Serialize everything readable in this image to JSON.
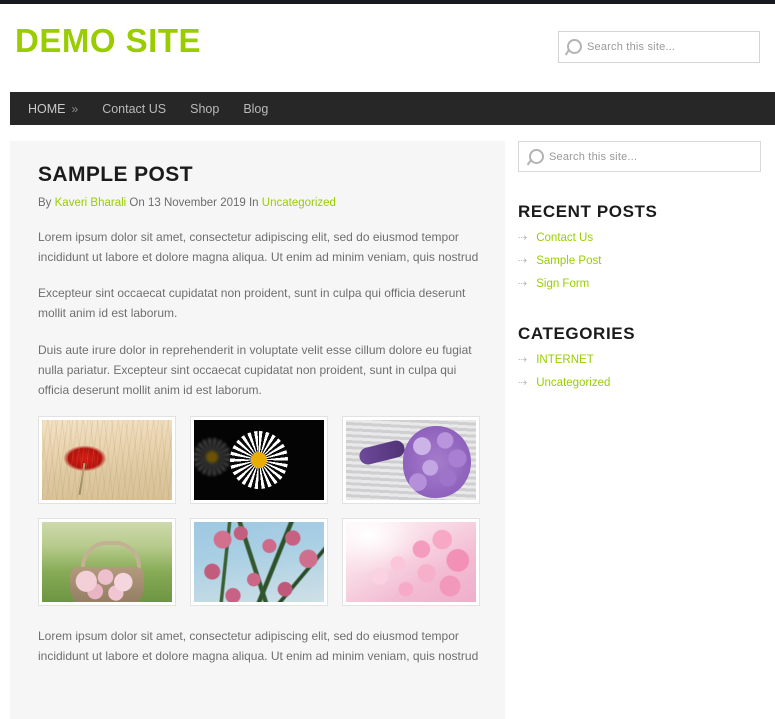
{
  "site": {
    "logo_text": "DEMO SITE",
    "logo_color": "#9ACD00"
  },
  "header": {
    "search": {
      "icon": "search-icon",
      "placeholder": "Search this site...",
      "value": ""
    }
  },
  "nav": {
    "items": [
      {
        "label": "HOME",
        "caret": "»",
        "has_caret": true
      },
      {
        "label": "Contact US",
        "has_caret": false
      },
      {
        "label": "Shop",
        "has_caret": false
      },
      {
        "label": "Blog",
        "has_caret": false
      }
    ]
  },
  "post": {
    "title": "SAMPLE POST",
    "byline": {
      "by_label": "By",
      "author": "Kaveri Bharali",
      "on_label": "On",
      "date": "13 November 2019",
      "in_label": "In",
      "category": "Uncategorized"
    },
    "paragraphs": [
      "Lorem ipsum dolor sit amet, consectetur adipiscing elit, sed do eiusmod tempor incididunt ut labore et dolore magna aliqua. Ut enim ad minim veniam, quis nostrud",
      "Excepteur sint occaecat cupidatat non proident, sunt in culpa qui officia deserunt mollit anim id est laborum.",
      "Duis aute irure dolor in reprehenderit in voluptate velit esse cillum dolore eu fugiat nulla pariatur. Excepteur sint occaecat cupidatat non proident, sunt in culpa qui officia deserunt mollit anim id est laborum."
    ],
    "gallery": [
      {
        "name": "red-poppy-in-wheat-field"
      },
      {
        "name": "white-daisy-on-black-background"
      },
      {
        "name": "purple-bouquet-on-knit-blanket"
      },
      {
        "name": "pink-roses-in-basket-on-grass"
      },
      {
        "name": "pink-blossoms-against-blue-sky"
      },
      {
        "name": "pale-pink-cherry-blossoms"
      }
    ],
    "closing_paragraph": "Lorem ipsum dolor sit amet, consectetur adipiscing elit, sed do eiusmod tempor incididunt ut labore et dolore magna aliqua. Ut enim ad minim veniam, quis nostrud"
  },
  "sidebar": {
    "search": {
      "icon": "search-icon",
      "placeholder": "Search this site...",
      "value": ""
    },
    "recent_posts": {
      "title": "RECENT POSTS",
      "bullet": "⇢",
      "items": [
        {
          "label": "Contact Us"
        },
        {
          "label": "Sample Post"
        },
        {
          "label": "Sign Form"
        }
      ]
    },
    "categories": {
      "title": "CATEGORIES",
      "bullet": "⇢",
      "items": [
        {
          "label": "INTERNET"
        },
        {
          "label": "Uncategorized"
        }
      ]
    }
  }
}
